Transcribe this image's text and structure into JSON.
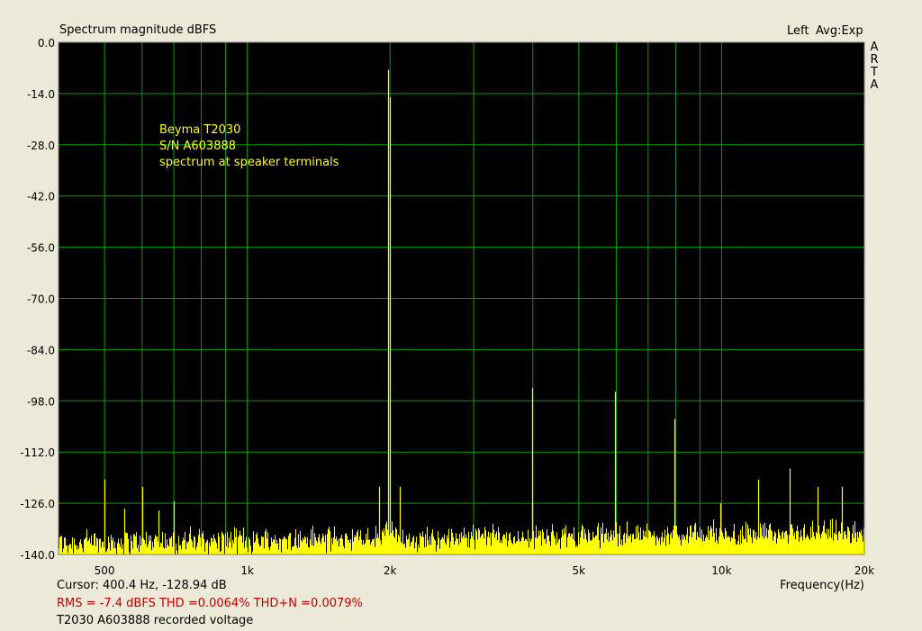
{
  "window": {
    "title": "Spectrum magnitude dBFS",
    "channel": "Left",
    "averaging": "Avg:Exp",
    "brand_letters": [
      "A",
      "R",
      "T",
      "A"
    ]
  },
  "annotation": {
    "lines": [
      "Beyma T2030",
      "S/N A603888",
      "spectrum at speaker terminals"
    ]
  },
  "status": {
    "cursor": "Cursor:   400.4 Hz, -128.94 dB",
    "measurements": "RMS =   -7.4 dBFS   THD =0.0064%   THD+N =0.0079%",
    "caption": "T2030 A603888 recorded voltage"
  },
  "colors": {
    "plot_background": "#000000",
    "grid": "#00A000",
    "trace": "#FFFF00",
    "annotation_text": "#FFFF00",
    "measurement_text": "#C00000"
  },
  "chart_data": {
    "type": "line",
    "title": "Spectrum magnitude dBFS",
    "xlabel": "Frequency(Hz)",
    "ylabel": "",
    "x_scale": "log",
    "xlim": [
      400,
      20000
    ],
    "ylim": [
      -140,
      0
    ],
    "grid": true,
    "y_ticks": [
      "0.0",
      "-14.0",
      "-28.0",
      "-42.0",
      "-56.0",
      "-70.0",
      "-84.0",
      "-98.0",
      "-112.0",
      "-126.0",
      "-140.0"
    ],
    "x_ticks": [
      {
        "value": 500,
        "label": "500"
      },
      {
        "value": 1000,
        "label": "1k"
      },
      {
        "value": 2000,
        "label": "2k"
      },
      {
        "value": 5000,
        "label": "5k"
      },
      {
        "value": 10000,
        "label": "10k"
      },
      {
        "value": 20000,
        "label": "20k"
      }
    ],
    "x_gridlines": [
      400,
      500,
      600,
      700,
      800,
      900,
      1000,
      2000,
      3000,
      4000,
      5000,
      6000,
      7000,
      8000,
      9000,
      10000,
      20000
    ],
    "noise_floor_db": -136,
    "series": [
      {
        "peaks": [
          {
            "x": 500,
            "y": -119.5
          },
          {
            "x": 550,
            "y": -127.5
          },
          {
            "x": 600,
            "y": -121.5
          },
          {
            "x": 650,
            "y": -128
          },
          {
            "x": 700,
            "y": -125.5
          },
          {
            "x": 1900,
            "y": -121.5
          },
          {
            "x": 1985,
            "y": -7.5
          },
          {
            "x": 1995,
            "y": -15
          },
          {
            "x": 2100,
            "y": -121.5
          },
          {
            "x": 3980,
            "y": -94.5
          },
          {
            "x": 3990,
            "y": -126
          },
          {
            "x": 5970,
            "y": -95.5
          },
          {
            "x": 6300,
            "y": -131
          },
          {
            "x": 7960,
            "y": -103
          },
          {
            "x": 9950,
            "y": -126
          },
          {
            "x": 11950,
            "y": -119.5
          },
          {
            "x": 13940,
            "y": -116.5
          },
          {
            "x": 15920,
            "y": -121.5
          },
          {
            "x": 17910,
            "y": -121.5
          }
        ]
      }
    ]
  }
}
